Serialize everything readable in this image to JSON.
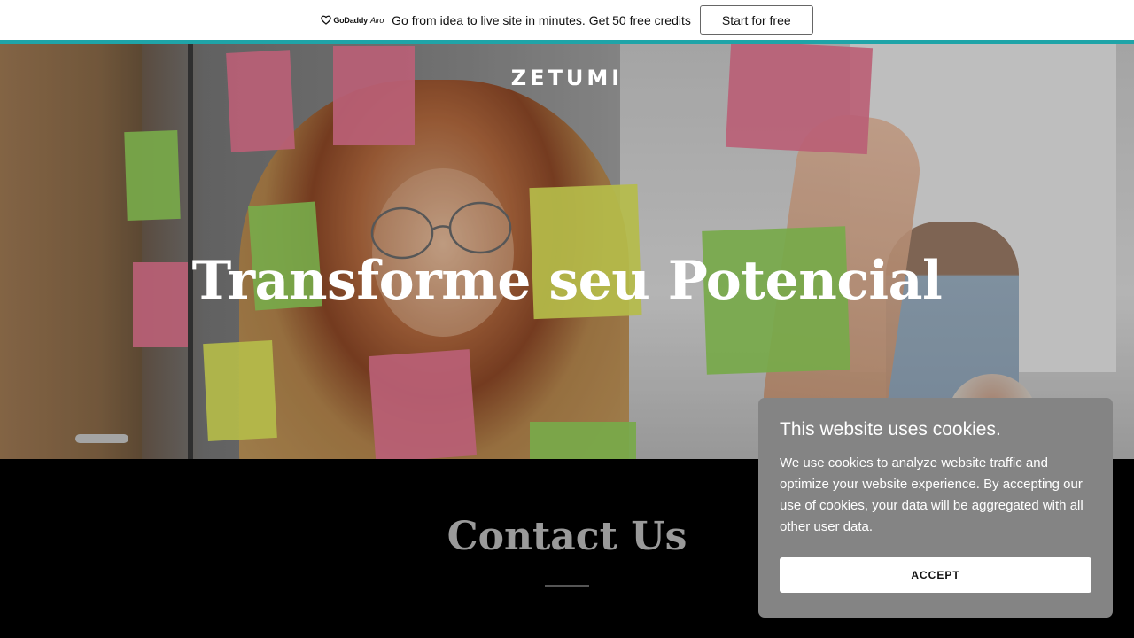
{
  "promo": {
    "logo_name": "GoDaddy",
    "logo_product": "Airo",
    "text": "Go from idea to live site in minutes. Get 50 free credits",
    "cta_label": "Start for free"
  },
  "hero": {
    "brand": "ZETUMI",
    "title": "Transforme seu Potencial"
  },
  "contact": {
    "title": "Contact Us"
  },
  "cookie": {
    "title": "This website uses cookies.",
    "text": "We use cookies to analyze website traffic and optimize your website experience. By accepting our use of cookies, your data will be aggregated with all other user data.",
    "accept_label": "ACCEPT"
  },
  "colors": {
    "accent_bar": "#1fa4a8",
    "cookie_bg": "#848484",
    "section_bg": "#000000"
  },
  "icons": {
    "promo_logo": "godaddy-heart-icon"
  }
}
